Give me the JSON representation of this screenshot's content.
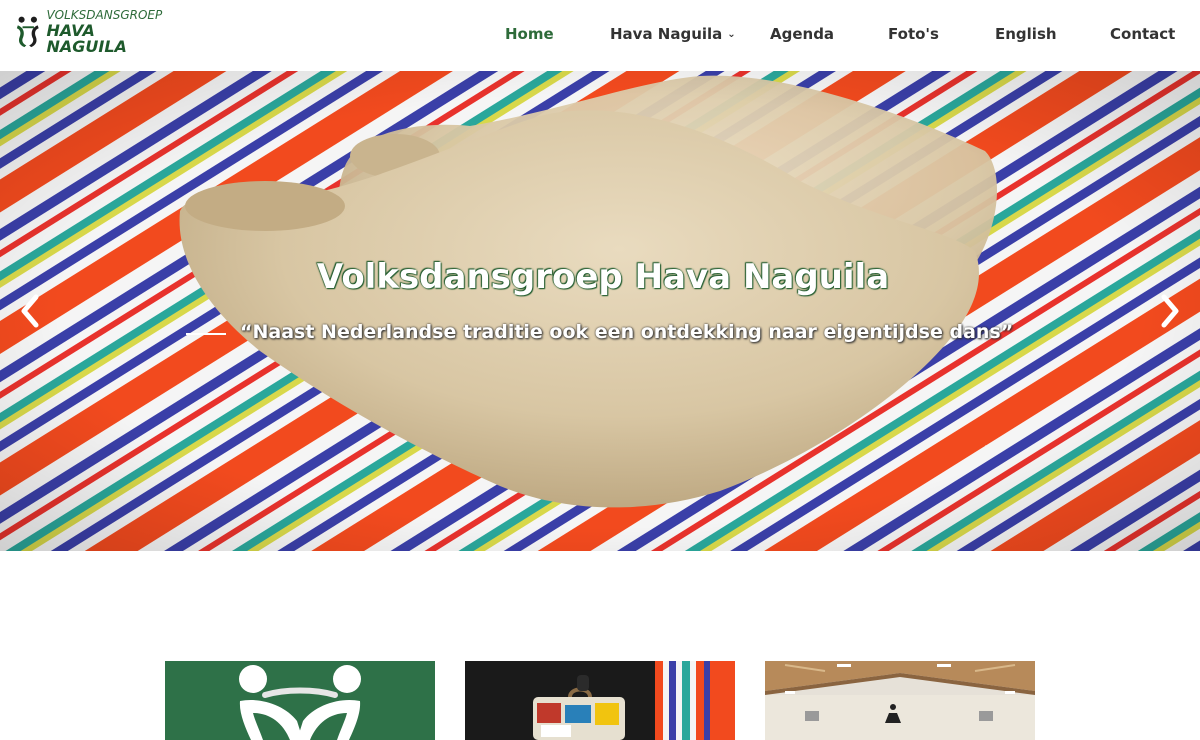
{
  "logo": {
    "line1": "VOLKSDANSGROEP",
    "line2": "HAVA NAGUILA"
  },
  "nav": {
    "items": [
      {
        "label": "Home"
      },
      {
        "label": "Hava Naguila"
      },
      {
        "label": "Agenda"
      },
      {
        "label": "Foto's"
      },
      {
        "label": "English"
      },
      {
        "label": "Contact"
      }
    ]
  },
  "hero": {
    "title": "Volksdansgroep Hava Naguila",
    "subtitle": "“Naast Nederlandse traditie ook een ontdekking naar eigentijdse dans”"
  },
  "colors": {
    "accent": "#2e6b3a",
    "nav_text": "#333333"
  },
  "icons": {
    "prev": "chevron-left-icon",
    "next": "chevron-right-icon",
    "dropdown": "chevron-down-icon"
  }
}
